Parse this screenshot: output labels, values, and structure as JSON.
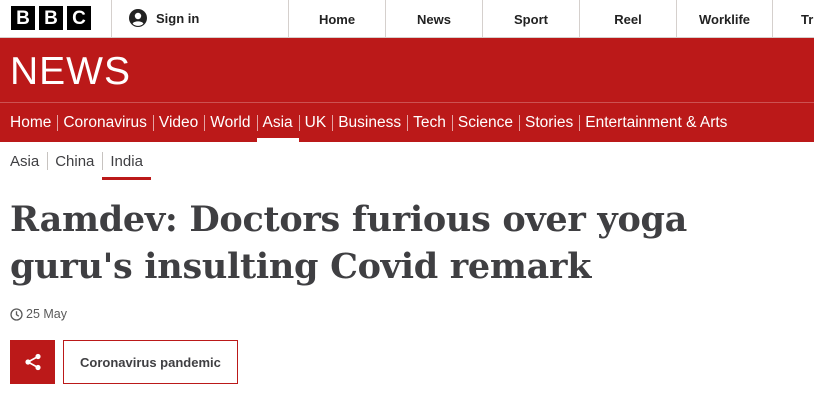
{
  "brand": {
    "logo_letters": [
      "B",
      "B",
      "C"
    ],
    "news_word": "NEWS",
    "colors": {
      "accent": "#bb1919",
      "text": "#3f3f42",
      "logo": "#000000"
    }
  },
  "topbar": {
    "signin_label": "Sign in",
    "signin_icon": "user-icon",
    "nav": [
      "Home",
      "News",
      "Sport",
      "Reel",
      "Worklife",
      "Tr"
    ]
  },
  "section_nav": {
    "items": [
      "Home",
      "Coronavirus",
      "Video",
      "World",
      "Asia",
      "UK",
      "Business",
      "Tech",
      "Science",
      "Stories",
      "Entertainment & Arts"
    ],
    "active": "Asia"
  },
  "sub_nav": {
    "items": [
      "Asia",
      "China",
      "India"
    ],
    "active": "India"
  },
  "article": {
    "headline": "Ramdev: Doctors furious over yoga guru's insulting Covid remark",
    "date": "25 May",
    "date_icon": "clock-icon",
    "share_icon": "share-icon",
    "tag": "Coronavirus pandemic"
  }
}
